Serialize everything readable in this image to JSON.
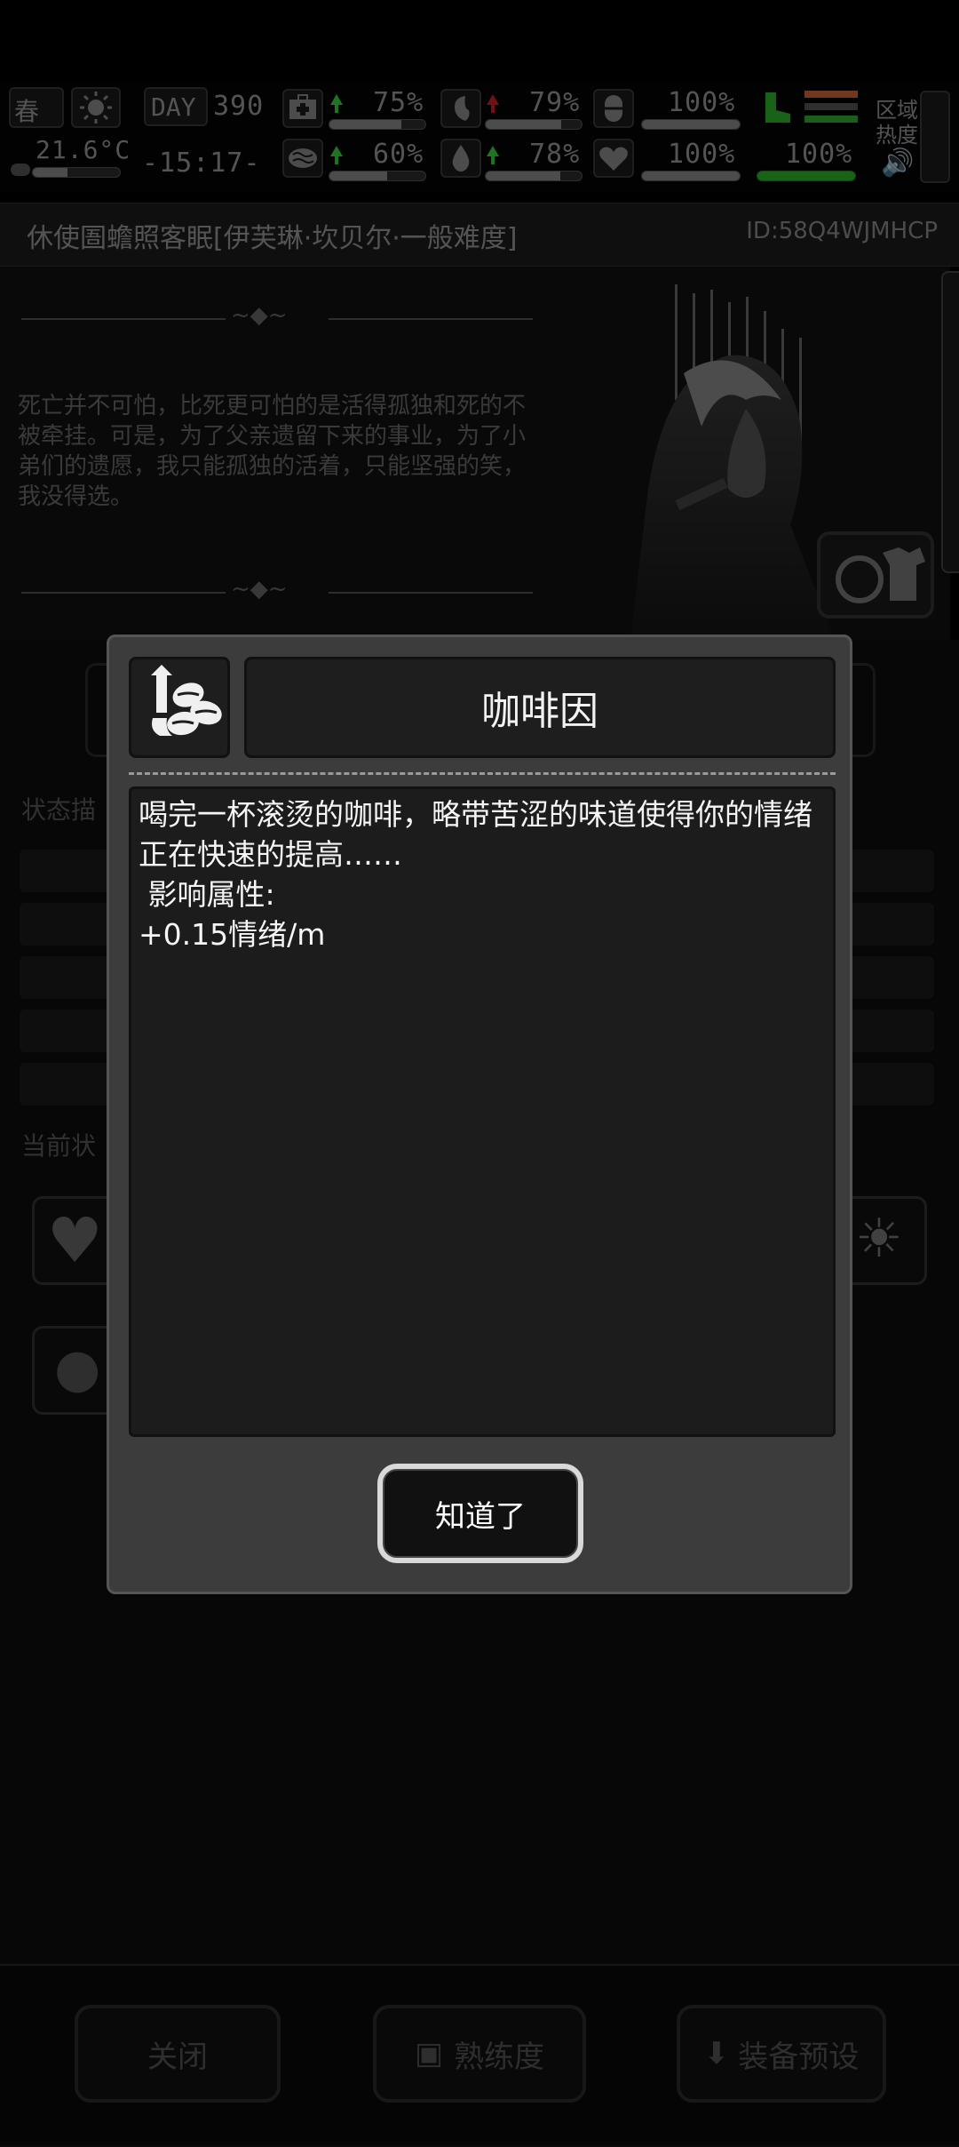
{
  "status_bar": {
    "season": "春",
    "temperature": "21.6°C",
    "day_label": "DAY",
    "day_number": "390",
    "clock": "-15:17-",
    "stats": [
      {
        "name": "health",
        "value": "75%",
        "trend": "up",
        "fill": 0.75
      },
      {
        "name": "stomach",
        "value": "79%",
        "trend": "down",
        "fill": 0.79
      },
      {
        "name": "stamina",
        "value": "100%",
        "trend": "none",
        "fill": 1.0
      },
      {
        "name": "sanity",
        "value": "60%",
        "trend": "up",
        "fill": 0.6
      },
      {
        "name": "water",
        "value": "78%",
        "trend": "up",
        "fill": 0.78
      },
      {
        "name": "mood",
        "value": "100%",
        "trend": "none",
        "fill": 1.0
      },
      {
        "name": "energy",
        "value": "100%",
        "trend": "none",
        "fill": 1.0
      }
    ],
    "region_heat_label_1": "区域",
    "region_heat_label_2": "热度",
    "colors": {
      "accent_green": "#3bd13b",
      "accent_red": "#cc2222"
    }
  },
  "title_bar": {
    "title": "休使圄蟾照客眠[伊芙琳·坎贝尔·一般难度]",
    "id": "ID:58Q4WJMHCP"
  },
  "story": {
    "text": "死亡并不可怕，比死更可怕的是活得孤独和死的不被牵挂。可是，为了父亲遗留下来的事业，为了小弟们的遗愿，我只能孤独的活着，只能坚强的笑，我没得选。"
  },
  "background": {
    "status_desc_label": "状态描",
    "current_status_label": "当前状"
  },
  "bottom_bar": {
    "close_label": "关闭",
    "proficiency_label": "熟练度",
    "preset_label": "装备预设"
  },
  "modal": {
    "title": "咖啡因",
    "icon": "coffee-beans-up-icon",
    "body_line1": "喝完一杯滚烫的咖啡，略带苦涩的味道使得你的情绪正在快速的提高……",
    "body_line2": " 影响属性:",
    "body_line3": "+0.15情绪/m",
    "ok_label": "知道了"
  }
}
